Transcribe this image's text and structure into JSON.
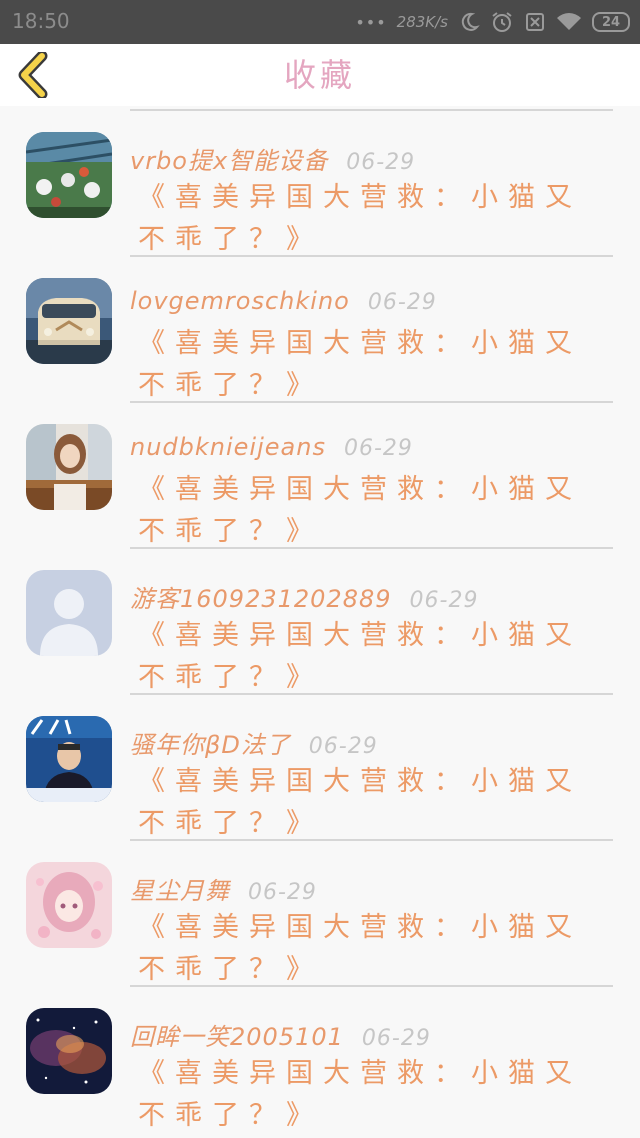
{
  "status_bar": {
    "time": "18:50",
    "dots": "•••",
    "speed": "283K/s",
    "battery": "24"
  },
  "header": {
    "title": "收藏"
  },
  "items": [
    {
      "user": "vrbo提x智能设备",
      "date": "06-29",
      "message": "《喜美异国大营救：小猫又不乖了？》",
      "avatar": "lanterns-avatar"
    },
    {
      "user": "lovgemroschkino",
      "date": "06-29",
      "message": "《喜美异国大营救：小猫又不乖了？》",
      "avatar": "van-avatar"
    },
    {
      "user": "nudbknieijeans",
      "date": "06-29",
      "message": "《喜美异国大营救：小猫又不乖了？》",
      "avatar": "girl-avatar"
    },
    {
      "user": "游客1609231202889",
      "date": "06-29",
      "message": "《喜美异国大营救：小猫又不乖了？》",
      "avatar": "default-avatar"
    },
    {
      "user": "骚年你βD法了",
      "date": "06-29",
      "message": "《喜美异国大营救：小猫又不乖了？》",
      "avatar": "news-avatar"
    },
    {
      "user": "星尘月舞",
      "date": "06-29",
      "message": "《喜美异国大营救：小猫又不乖了？》",
      "avatar": "anime-avatar"
    },
    {
      "user": "回眸一笑2005101",
      "date": "06-29",
      "message": "《喜美异国大营救：小猫又不乖了？》",
      "avatar": "nebula-avatar"
    }
  ],
  "colors": {
    "title": "#e4a6c0",
    "username": "#e8996b",
    "message": "#ec9a66",
    "date": "#c6c6c6",
    "back_icon": "#f5d34a"
  }
}
